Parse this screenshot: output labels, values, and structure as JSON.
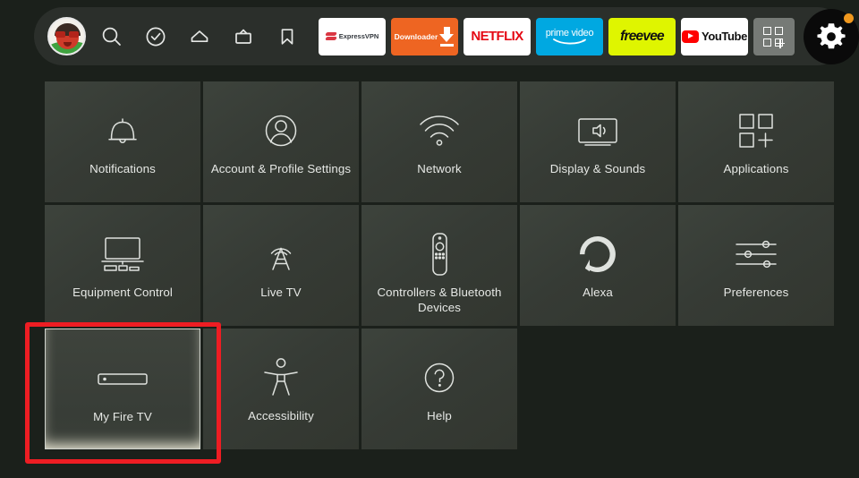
{
  "topbar": {
    "profile": {
      "name": "profile-avatar",
      "label": "Profile"
    },
    "nav_icons": [
      {
        "name": "search-icon",
        "label": "Search"
      },
      {
        "name": "watchlist-check-icon",
        "label": "Watchlist"
      },
      {
        "name": "home-icon",
        "label": "Home"
      },
      {
        "name": "live-tv-icon",
        "label": "Live"
      },
      {
        "name": "bookmark-icon",
        "label": "Library"
      }
    ],
    "apps": [
      {
        "name": "app-expressvpn",
        "label": "ExpressVPN",
        "bg": "#ffffff",
        "fg": "#32373d"
      },
      {
        "name": "app-downloader",
        "label": "Downloader",
        "bg": "#ee6522",
        "fg": "#ffffff"
      },
      {
        "name": "app-netflix",
        "label": "NETFLIX",
        "bg": "#ffffff",
        "fg": "#e50914"
      },
      {
        "name": "app-prime-video",
        "label": "prime video",
        "bg": "#00a8e1",
        "fg": "#ffffff"
      },
      {
        "name": "app-freevee",
        "label": "freevee",
        "bg": "#dff500",
        "fg": "#111111"
      },
      {
        "name": "app-youtube",
        "label": "YouTube",
        "bg": "#ffffff",
        "fg": "#111111"
      }
    ],
    "apps_grid_button": {
      "name": "apps-grid-button",
      "label": "Apps"
    },
    "settings_button": {
      "name": "settings-gear-button",
      "label": "Settings",
      "badge": true,
      "badge_color": "#f0981e",
      "selected": true
    }
  },
  "settings_grid": {
    "tiles": [
      {
        "label": "Notifications",
        "icon": "bell-icon"
      },
      {
        "label": "Account & Profile Settings",
        "icon": "person-circle-icon"
      },
      {
        "label": "Network",
        "icon": "wifi-icon"
      },
      {
        "label": "Display & Sounds",
        "icon": "tv-speaker-icon"
      },
      {
        "label": "Applications",
        "icon": "apps-grid-plus-icon"
      },
      {
        "label": "Equipment Control",
        "icon": "tv-soundbar-icon"
      },
      {
        "label": "Live TV",
        "icon": "broadcast-tower-icon"
      },
      {
        "label": "Controllers & Bluetooth Devices",
        "icon": "remote-control-icon"
      },
      {
        "label": "Alexa",
        "icon": "alexa-ring-icon"
      },
      {
        "label": "Preferences",
        "icon": "sliders-icon"
      },
      {
        "label": "My Fire TV",
        "icon": "fire-tv-stick-icon",
        "focused": true
      },
      {
        "label": "Accessibility",
        "icon": "accessibility-person-icon"
      },
      {
        "label": "Help",
        "icon": "question-circle-icon"
      }
    ]
  },
  "annotation": {
    "name": "focus-highlight-box",
    "color": "#ee1d23",
    "target": "My Fire TV"
  },
  "colors": {
    "page_background": "#1b201b",
    "topbar_background": "#2b2f2b",
    "tile_background": "#383d37",
    "tile_text": "#e6e8e5",
    "icon_stroke": "#dfe2de",
    "highlight_red": "#ee1d23"
  }
}
